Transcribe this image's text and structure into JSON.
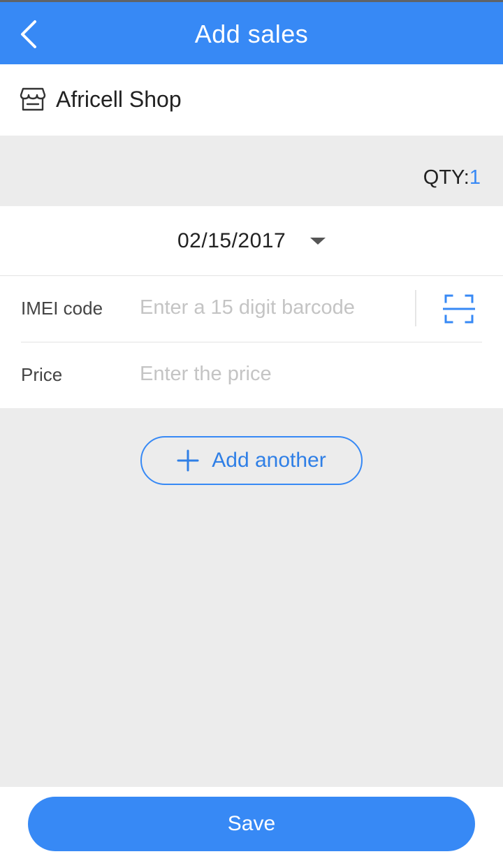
{
  "header": {
    "title": "Add sales",
    "back_icon": "chevron-left-icon"
  },
  "shop": {
    "icon": "store-icon",
    "name": "Africell Shop"
  },
  "qty": {
    "label": "QTY:",
    "value": "1"
  },
  "form": {
    "date": "02/15/2017",
    "date_icon": "caret-down-icon",
    "imei": {
      "label": "IMEI code",
      "value": "",
      "placeholder": "Enter a 15 digit barcode",
      "scan_icon": "barcode-scan-icon"
    },
    "price": {
      "label": "Price",
      "value": "",
      "placeholder": "Enter the price"
    }
  },
  "actions": {
    "add_another_label": "Add another",
    "add_icon": "plus-icon",
    "save_label": "Save"
  },
  "colors": {
    "accent": "#3789f5",
    "background": "#ececec",
    "surface": "#ffffff",
    "placeholder": "#c4c4c4"
  }
}
